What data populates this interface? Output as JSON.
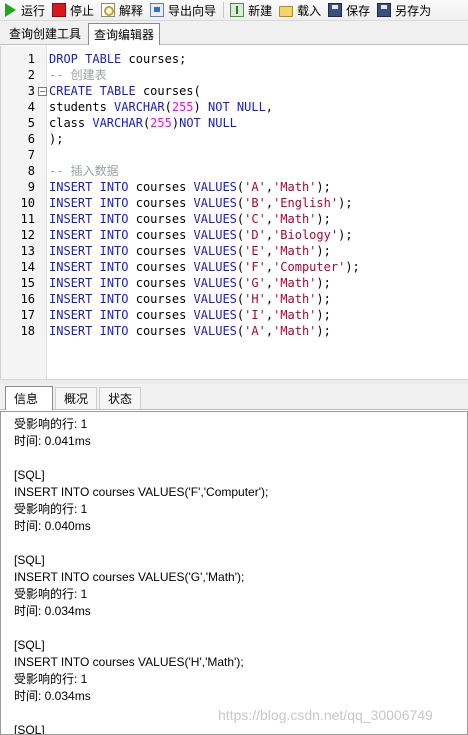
{
  "toolbar": {
    "run": "运行",
    "stop": "停止",
    "explain": "解释",
    "export_wizard": "导出向导",
    "new": "新建",
    "load": "载入",
    "save": "保存",
    "save_as": "另存为"
  },
  "top_tabs": [
    "查询创建工具",
    "查询编辑器"
  ],
  "editor": {
    "line_numbers": [
      "1",
      "2",
      "3",
      "4",
      "5",
      "6",
      "7",
      "8",
      "9",
      "10",
      "11",
      "12",
      "13",
      "14",
      "15",
      "16",
      "17",
      "18"
    ]
  },
  "code_lines": {
    "l1": {
      "kw1": "DROP",
      "kw2": "TABLE",
      "ident": "courses;"
    },
    "l2": {
      "comment": "-- 创建表"
    },
    "l3": {
      "kw1": "CREATE",
      "kw2": "TABLE",
      "ident": "courses("
    },
    "l4": {
      "ident": "students",
      "type": "VARCHAR",
      "num": "255",
      "kw": "NOT NULL",
      "end": ","
    },
    "l5": {
      "ident": "class",
      "type": "VARCHAR",
      "num": "255",
      "kw": "NOT NULL"
    },
    "l6": {
      "text": ");"
    },
    "l8": {
      "comment": "-- 插入数据"
    },
    "inserts": [
      {
        "student": "'A'",
        "class": "'Math'"
      },
      {
        "student": "'B'",
        "class": "'English'"
      },
      {
        "student": "'C'",
        "class": "'Math'"
      },
      {
        "student": "'D'",
        "class": "'Biology'"
      },
      {
        "student": "'E'",
        "class": "'Math'"
      },
      {
        "student": "'F'",
        "class": "'Computer'"
      },
      {
        "student": "'G'",
        "class": "'Math'"
      },
      {
        "student": "'H'",
        "class": "'Math'"
      },
      {
        "student": "'I'",
        "class": "'Math'"
      },
      {
        "student": "'A'",
        "class": "'Math'"
      }
    ],
    "insert_kw": "INSERT",
    "into_kw": "INTO",
    "table": "courses",
    "values_kw": "VALUES"
  },
  "bottom_tabs": [
    "信息",
    "概况",
    "状态"
  ],
  "output_lines": [
    "受影响的行: 1",
    "时间: 0.041ms",
    "",
    "[SQL]",
    "INSERT INTO courses VALUES('F','Computer');",
    "受影响的行: 1",
    "时间: 0.040ms",
    "",
    "[SQL]",
    "INSERT INTO courses VALUES('G','Math');",
    "受影响的行: 1",
    "时间: 0.034ms",
    "",
    "[SQL]",
    "INSERT INTO courses VALUES('H','Math');",
    "受影响的行: 1",
    "时间: 0.034ms",
    "",
    "[SQL]"
  ],
  "watermark": "https://blog.csdn.net/qq_30006749",
  "colors": {
    "keyword": "#1a1acc",
    "string": "#b8002e",
    "comment": "#9aa0a6",
    "number": "#ff00ff"
  }
}
